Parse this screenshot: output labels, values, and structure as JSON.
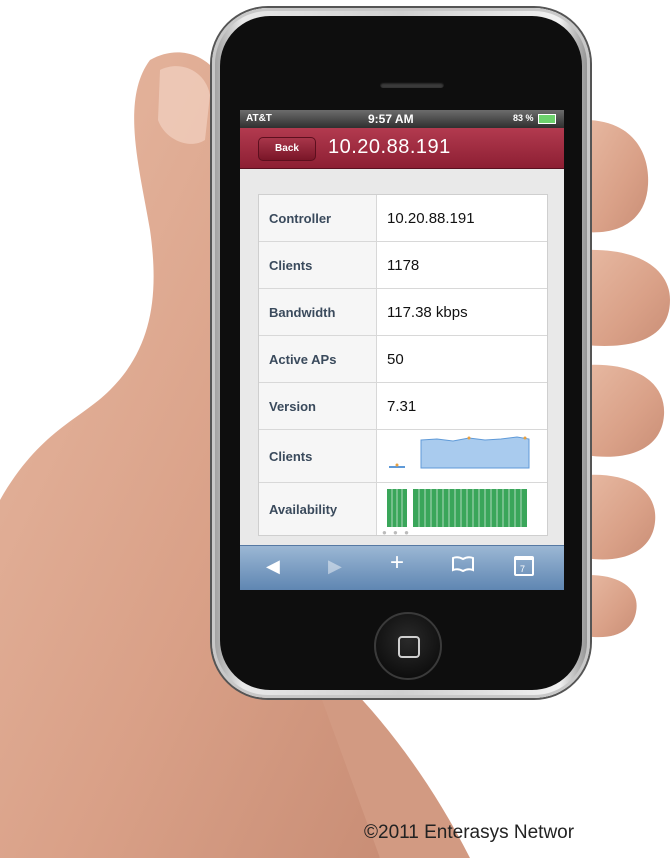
{
  "status_bar": {
    "carrier": "AT&T",
    "time": "9:57 AM",
    "battery": "83 %"
  },
  "nav": {
    "back_label": "Back",
    "title": "10.20.88.191"
  },
  "details": [
    {
      "label": "Controller",
      "value": "10.20.88.191"
    },
    {
      "label": "Clients",
      "value": "1178"
    },
    {
      "label": "Bandwidth",
      "value": "117.38 kbps"
    },
    {
      "label": "Active APs",
      "value": "50"
    },
    {
      "label": "Version",
      "value": "7.31"
    }
  ],
  "charts": {
    "clients_label": "Clients",
    "availability_label": "Availability"
  },
  "toolbar": {
    "icons": [
      "back-arrow-icon",
      "forward-arrow-icon",
      "add-icon",
      "bookmarks-icon",
      "pages-icon"
    ],
    "pages_count": "7"
  },
  "footer": {
    "copyright": "©2011 Enterasys Networ"
  },
  "colors": {
    "nav_bar": "#9b2a3e",
    "toolbar": "#6f92bb",
    "sparkline_fill": "#a9cbee",
    "availability_bar": "#3aa65a"
  }
}
